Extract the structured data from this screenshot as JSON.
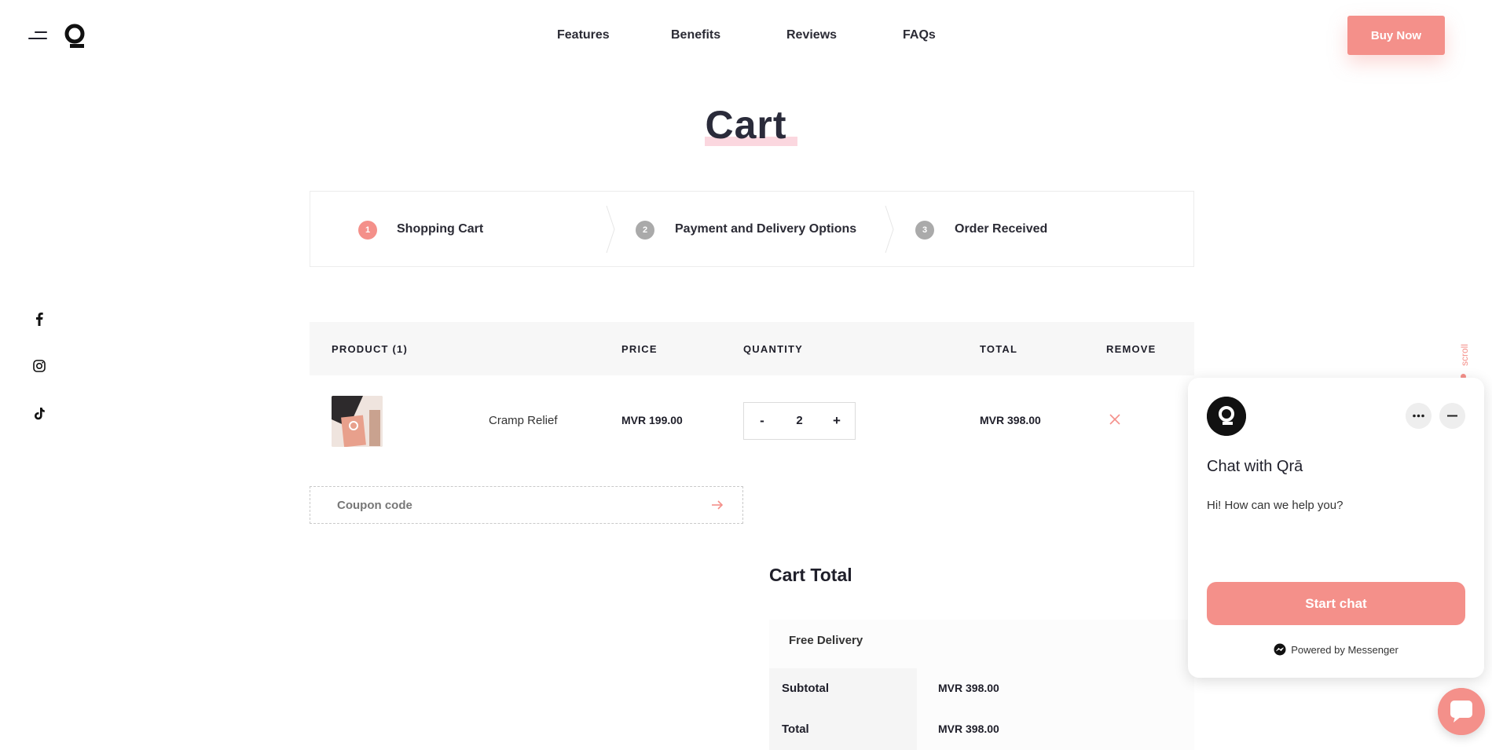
{
  "header": {
    "nav": [
      {
        "label": "Features"
      },
      {
        "label": "Benefits"
      },
      {
        "label": "Reviews"
      },
      {
        "label": "FAQs"
      }
    ],
    "buy_label": "Buy Now"
  },
  "page": {
    "title": "Cart"
  },
  "steps": [
    {
      "num": "1",
      "label": "Shopping Cart",
      "active": true
    },
    {
      "num": "2",
      "label": "Payment and Delivery Options",
      "active": false
    },
    {
      "num": "3",
      "label": "Order Received",
      "active": false
    }
  ],
  "table": {
    "headers": {
      "product": "PRODUCT (1)",
      "price": "PRICE",
      "quantity": "QUANTITY",
      "total": "TOTAL",
      "remove": "REMOVE"
    },
    "rows": [
      {
        "name": "Cramp Relief",
        "price": "MVR 199.00",
        "qty": "2",
        "total": "MVR 398.00",
        "minus": "-",
        "plus": "+"
      }
    ]
  },
  "coupon": {
    "placeholder": "Coupon code"
  },
  "cart_total": {
    "title": "Cart Total",
    "delivery": "Free Delivery",
    "subtotal_label": "Subtotal",
    "subtotal_value": "MVR 398.00",
    "total_label": "Total",
    "total_value": "MVR 398.00"
  },
  "scroll": {
    "label": "scroll"
  },
  "chat": {
    "title": "Chat with Qrā",
    "message": "Hi! How can we help you?",
    "start_label": "Start chat",
    "powered": "Powered by Messenger"
  },
  "colors": {
    "accent": "#f4908a",
    "text": "#1f1f2a",
    "underline": "#fbd7df"
  }
}
